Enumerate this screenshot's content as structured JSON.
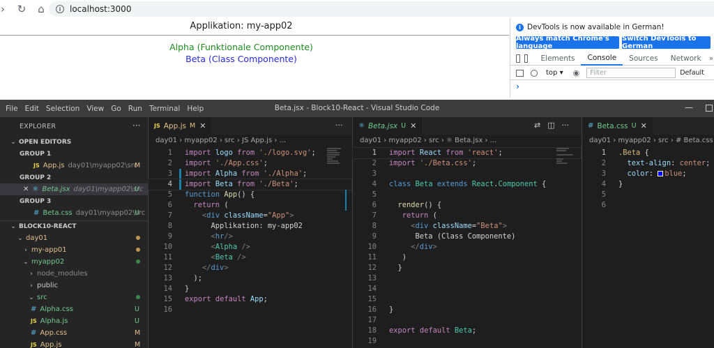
{
  "browser": {
    "url": "localhost:3000"
  },
  "page": {
    "title": "Applikation: my-app02",
    "alpha": "Alpha (Funktionale Componente)",
    "beta": "Beta (Class Componente)"
  },
  "devtools": {
    "info": "DevTools is now available in German!",
    "btn_match": "Always match Chrome's language",
    "btn_switch": "Switch DevTools to German",
    "tabs": [
      "Elements",
      "Console",
      "Sources",
      "Network"
    ],
    "active_tab": "Console",
    "more": "»",
    "context": "top ▾",
    "filter_placeholder": "Filter",
    "levels": "Default",
    "prompt": "›"
  },
  "vscode": {
    "menu": [
      "File",
      "Edit",
      "Selection",
      "View",
      "Go",
      "Run",
      "Terminal",
      "Help"
    ],
    "window_title": "Beta.jsx - Block10-React - Visual Studio Code",
    "explorer": {
      "header": "EXPLORER",
      "open_editors": "OPEN EDITORS",
      "group1": "GROUP 1",
      "group1_file": "App.js",
      "group1_path": "day01\\myapp02\\src",
      "group1_status": "M",
      "group2": "GROUP 2",
      "group2_file": "Beta.jsx",
      "group2_path": "day01\\myapp02\\src",
      "group2_status": "U",
      "group3": "GROUP 3",
      "group3_file": "Beta.css",
      "group3_path": "day01\\myapp02\\src",
      "group3_status": "U",
      "project": "BLOCK10-REACT",
      "tree": {
        "day01": "day01",
        "my_app01": "my-app01",
        "myapp02": "myapp02",
        "node_modules": "node_modules",
        "public": "public",
        "src": "src",
        "alpha_css": "Alpha.css",
        "alpha_css_status": "U",
        "alpha_js": "Alpha.js",
        "alpha_js_status": "U",
        "app_css": "App.css",
        "app_css_status": "M",
        "app_js": "App.js",
        "app_js_status": "M"
      }
    },
    "editor1": {
      "tab": "App.js",
      "tab_status": "M",
      "breadcrumb": "day01 › myapp02 › src › JS App.js › ...",
      "lines": [
        "1",
        "2",
        "3",
        "4",
        "5",
        "6",
        "7",
        "8",
        "9",
        "10",
        "11",
        "12",
        "13",
        "14",
        "15",
        "16"
      ]
    },
    "editor2": {
      "tab": "Beta.jsx",
      "tab_status": "U",
      "breadcrumb": "day01 › myapp02 › src › ⚛ Beta.jsx › ...",
      "lines": [
        "1",
        "2",
        "3",
        "4",
        "5",
        "6",
        "7",
        "8",
        "9",
        "10",
        "11",
        "12",
        "13",
        "14",
        "15",
        "16",
        "17",
        "18",
        "19"
      ]
    },
    "editor3": {
      "tab": "Beta.css",
      "tab_status": "U",
      "breadcrumb": "day01 › myapp02 › src › # Beta.css",
      "lines": [
        "1",
        "2",
        "3",
        "4",
        "5",
        "6"
      ]
    }
  }
}
